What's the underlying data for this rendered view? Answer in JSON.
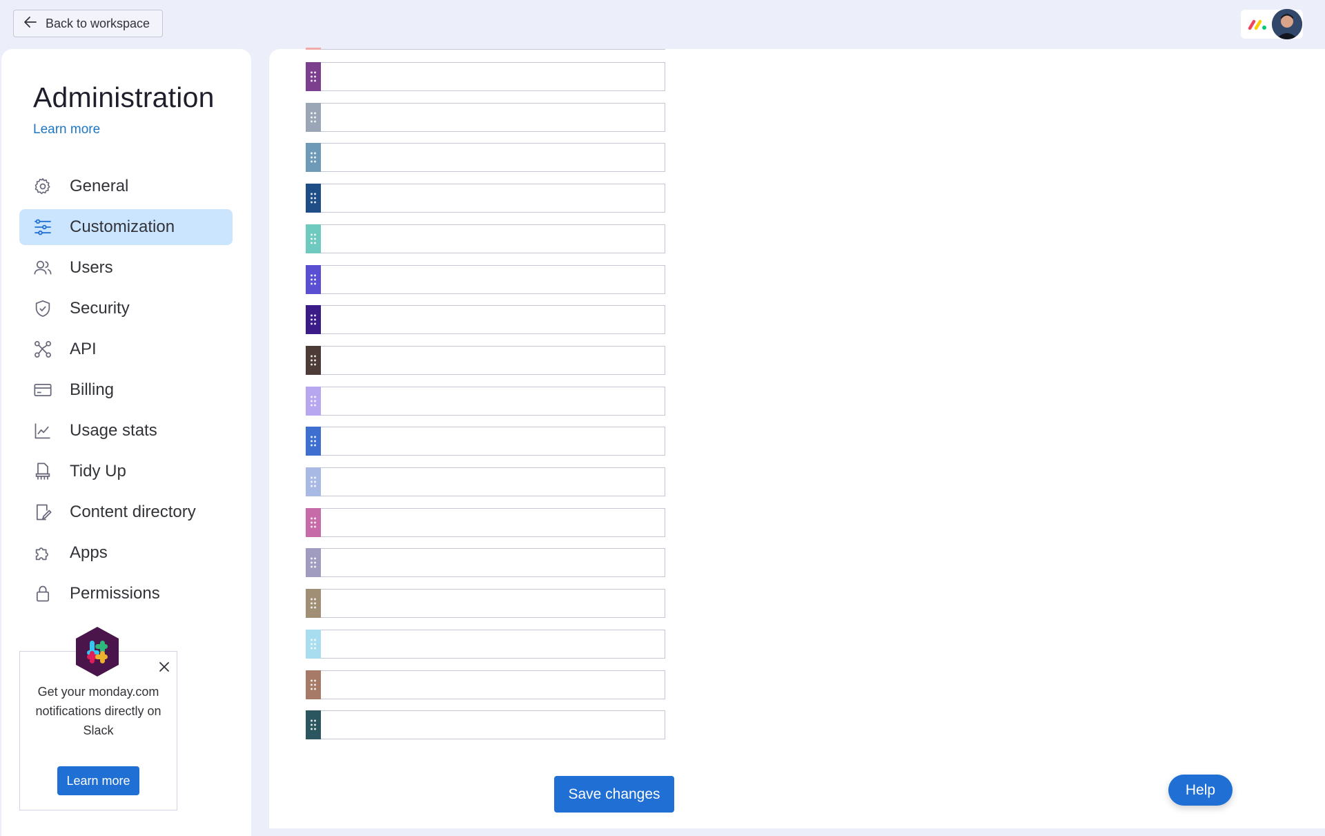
{
  "topbar": {
    "back_label": "Back to workspace"
  },
  "sidebar": {
    "title": "Administration",
    "learn_more": "Learn more",
    "active_item": "Customization",
    "items": [
      {
        "label": "General",
        "icon": "gear-icon"
      },
      {
        "label": "Customization",
        "icon": "sliders-icon"
      },
      {
        "label": "Users",
        "icon": "users-icon"
      },
      {
        "label": "Security",
        "icon": "shield-icon"
      },
      {
        "label": "API",
        "icon": "api-icon"
      },
      {
        "label": "Billing",
        "icon": "credit-card-icon"
      },
      {
        "label": "Usage stats",
        "icon": "chart-icon"
      },
      {
        "label": "Tidy Up",
        "icon": "broom-icon"
      },
      {
        "label": "Content directory",
        "icon": "document-edit-icon"
      },
      {
        "label": "Apps",
        "icon": "puzzle-icon"
      },
      {
        "label": "Permissions",
        "icon": "lock-icon"
      }
    ]
  },
  "promo": {
    "text": "Get your monday.com notifications directly on Slack",
    "button": "Learn more",
    "icon": "slack-icon"
  },
  "colors": {
    "accent": "#1f6fd4",
    "active_nav_bg": "#cce5ff",
    "swatches": [
      "#7b3f8e",
      "#9aa6b6",
      "#6e9ab8",
      "#1f4e86",
      "#6ec9bf",
      "#5a4fd3",
      "#3b1b87",
      "#4d3b38",
      "#b7a6f0",
      "#3e6fd0",
      "#a8b9e3",
      "#c66aa8",
      "#a09cbf",
      "#a08e75",
      "#a8dcef",
      "#a77a68",
      "#2b5660"
    ]
  },
  "color_rows": [
    {
      "value": ""
    },
    {
      "value": ""
    },
    {
      "value": ""
    },
    {
      "value": ""
    },
    {
      "value": ""
    },
    {
      "value": ""
    },
    {
      "value": ""
    },
    {
      "value": ""
    },
    {
      "value": ""
    },
    {
      "value": ""
    },
    {
      "value": ""
    },
    {
      "value": ""
    },
    {
      "value": ""
    },
    {
      "value": ""
    },
    {
      "value": ""
    },
    {
      "value": ""
    },
    {
      "value": ""
    }
  ],
  "actions": {
    "save_label": "Save changes",
    "help_label": "Help"
  }
}
